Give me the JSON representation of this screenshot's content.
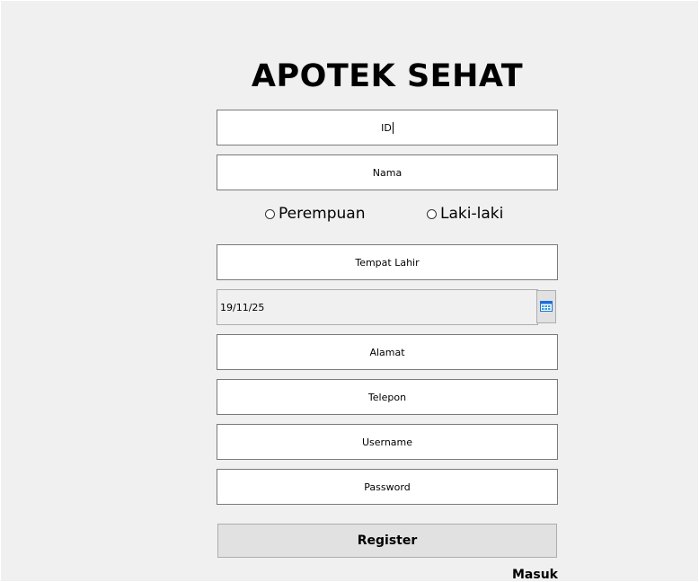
{
  "app": {
    "title": "APOTEK SEHAT"
  },
  "form": {
    "id_value": "ID",
    "nama_placeholder": "Nama",
    "gender_options": [
      "Perempuan",
      "Laki-laki"
    ],
    "tempat_lahir_placeholder": "Tempat Lahir",
    "tanggal_lahir_value": "19/11/25",
    "alamat_placeholder": "Alamat",
    "telepon_placeholder": "Telepon",
    "username_placeholder": "Username",
    "password_placeholder": "Password",
    "register_label": "Register",
    "masuk_label": "Masuk"
  },
  "icons": {
    "date_picker": "calendar-icon"
  },
  "colors": {
    "window_bg": "#f0f0f0",
    "field_bg": "#ffffff",
    "field_border": "#7a7a7a",
    "button_bg": "#e1e1e1",
    "calendar_accent": "#1e90ff"
  }
}
